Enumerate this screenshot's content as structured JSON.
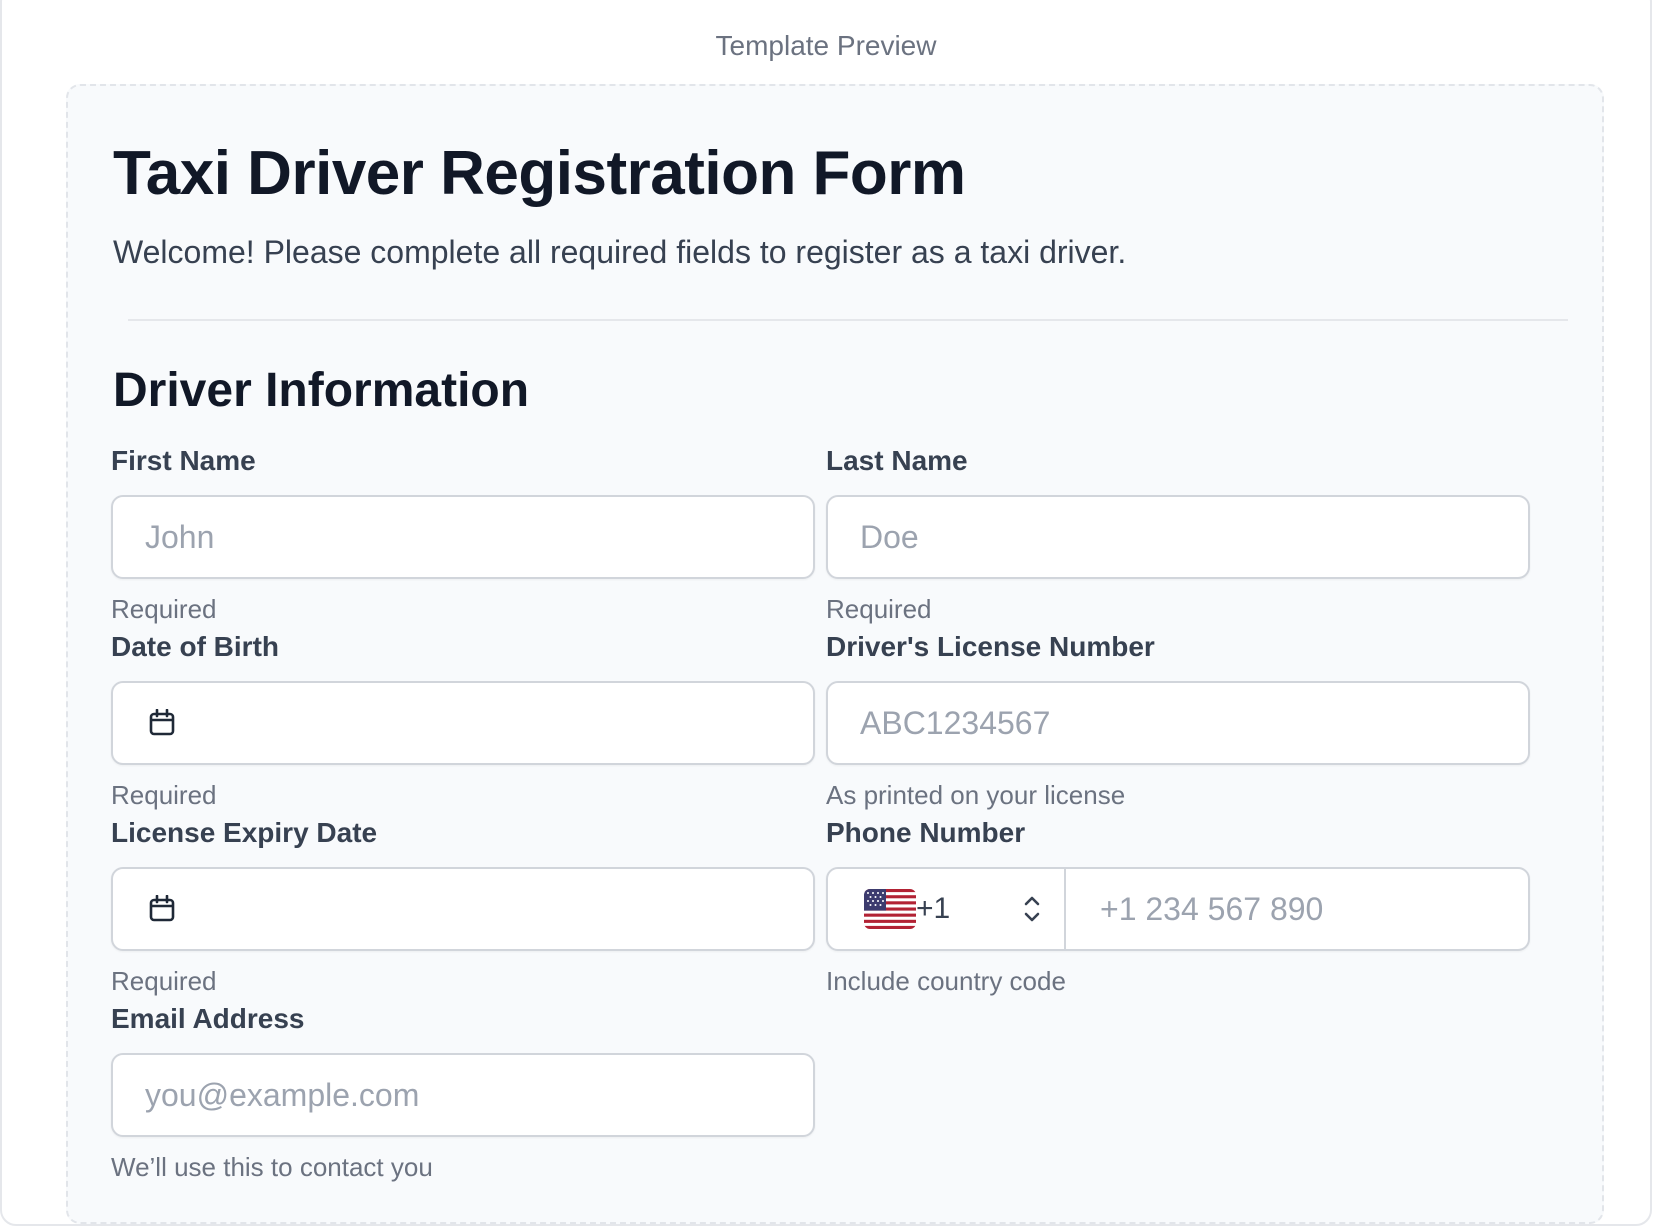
{
  "preview_label": "Template Preview",
  "form": {
    "title": "Taxi Driver Registration Form",
    "subtitle": "Welcome! Please complete all required fields to register as a taxi driver."
  },
  "section": {
    "title": "Driver Information"
  },
  "fields": {
    "first_name": {
      "label": "First Name",
      "placeholder": "John",
      "help": "Required"
    },
    "last_name": {
      "label": "Last Name",
      "placeholder": "Doe",
      "help": "Required"
    },
    "dob": {
      "label": "Date of Birth",
      "help": "Required",
      "icon": "calendar-icon"
    },
    "license_number": {
      "label": "Driver's License Number",
      "placeholder": "ABC1234567",
      "help": "As printed on your license"
    },
    "license_expiry": {
      "label": "License Expiry Date",
      "help": "Required",
      "icon": "calendar-icon"
    },
    "phone": {
      "label": "Phone Number",
      "country_flag": "us-flag-icon",
      "dial_code": "+1",
      "placeholder": "+1 234 567 890",
      "help": "Include country code"
    },
    "email": {
      "label": "Email Address",
      "placeholder": "you@example.com",
      "help": "We’ll use this to contact you"
    }
  },
  "colors": {
    "panel_background": "#f8fafc",
    "title_text": "#111827",
    "label_text": "#374151",
    "help_text": "#6b7280",
    "placeholder_text": "#9ca3af",
    "input_border": "#d1d5db"
  }
}
